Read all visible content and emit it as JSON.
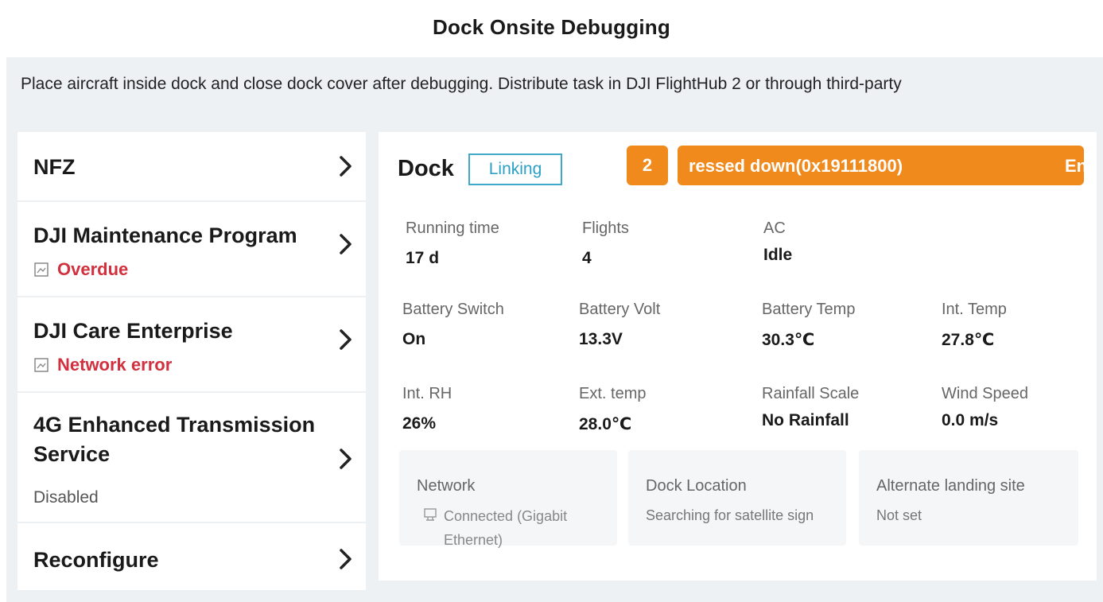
{
  "header": {
    "title": "Dock Onsite Debugging"
  },
  "notice": "Place aircraft inside dock and close dock cover after debugging. Distribute task in DJI FlightHub 2 or through third-party",
  "sidebar": {
    "items": [
      {
        "label": "NFZ"
      },
      {
        "label": "DJI Maintenance Program",
        "status": "Overdue",
        "status_color": "#d2303e"
      },
      {
        "label": "DJI Care Enterprise",
        "status": "Network error",
        "status_color": "#d2303e"
      },
      {
        "label": "4G Enhanced Transmission Service",
        "status": "Disabled"
      },
      {
        "label": "Reconfigure"
      }
    ],
    "chevron_icon": "chevron-right-icon"
  },
  "dock": {
    "title": "Dock",
    "badge": "Linking",
    "badge_color": "#2aa0c6",
    "alert": {
      "count": "2",
      "message": "ressed down(0x19111800)",
      "tail": "En",
      "color": "#f08a1c"
    },
    "stats": [
      {
        "label": "Running time",
        "value": "17 d"
      },
      {
        "label": "Flights",
        "value": "4"
      },
      {
        "label": "AC",
        "value": "Idle"
      },
      {
        "label": "Battery Switch",
        "value": "On"
      },
      {
        "label": "Battery Volt",
        "value": "13.3V"
      },
      {
        "label": "Battery Temp",
        "value": "30.3℃"
      },
      {
        "label": "Int. Temp",
        "value": "27.8℃"
      },
      {
        "label": "Int. RH",
        "value": "26%"
      },
      {
        "label": "Ext. temp",
        "value": "28.0℃"
      },
      {
        "label": "Rainfall Scale",
        "value": "No Rainfall"
      },
      {
        "label": "Wind Speed",
        "value": "0.0 m/s"
      }
    ],
    "cards": [
      {
        "label": "Network",
        "value": "Connected (Gigabit Ethernet)",
        "icon": "ethernet-icon"
      },
      {
        "label": "Dock Location",
        "value": "Searching for satellite sign"
      },
      {
        "label": "Alternate landing site",
        "value": "Not set"
      }
    ]
  }
}
